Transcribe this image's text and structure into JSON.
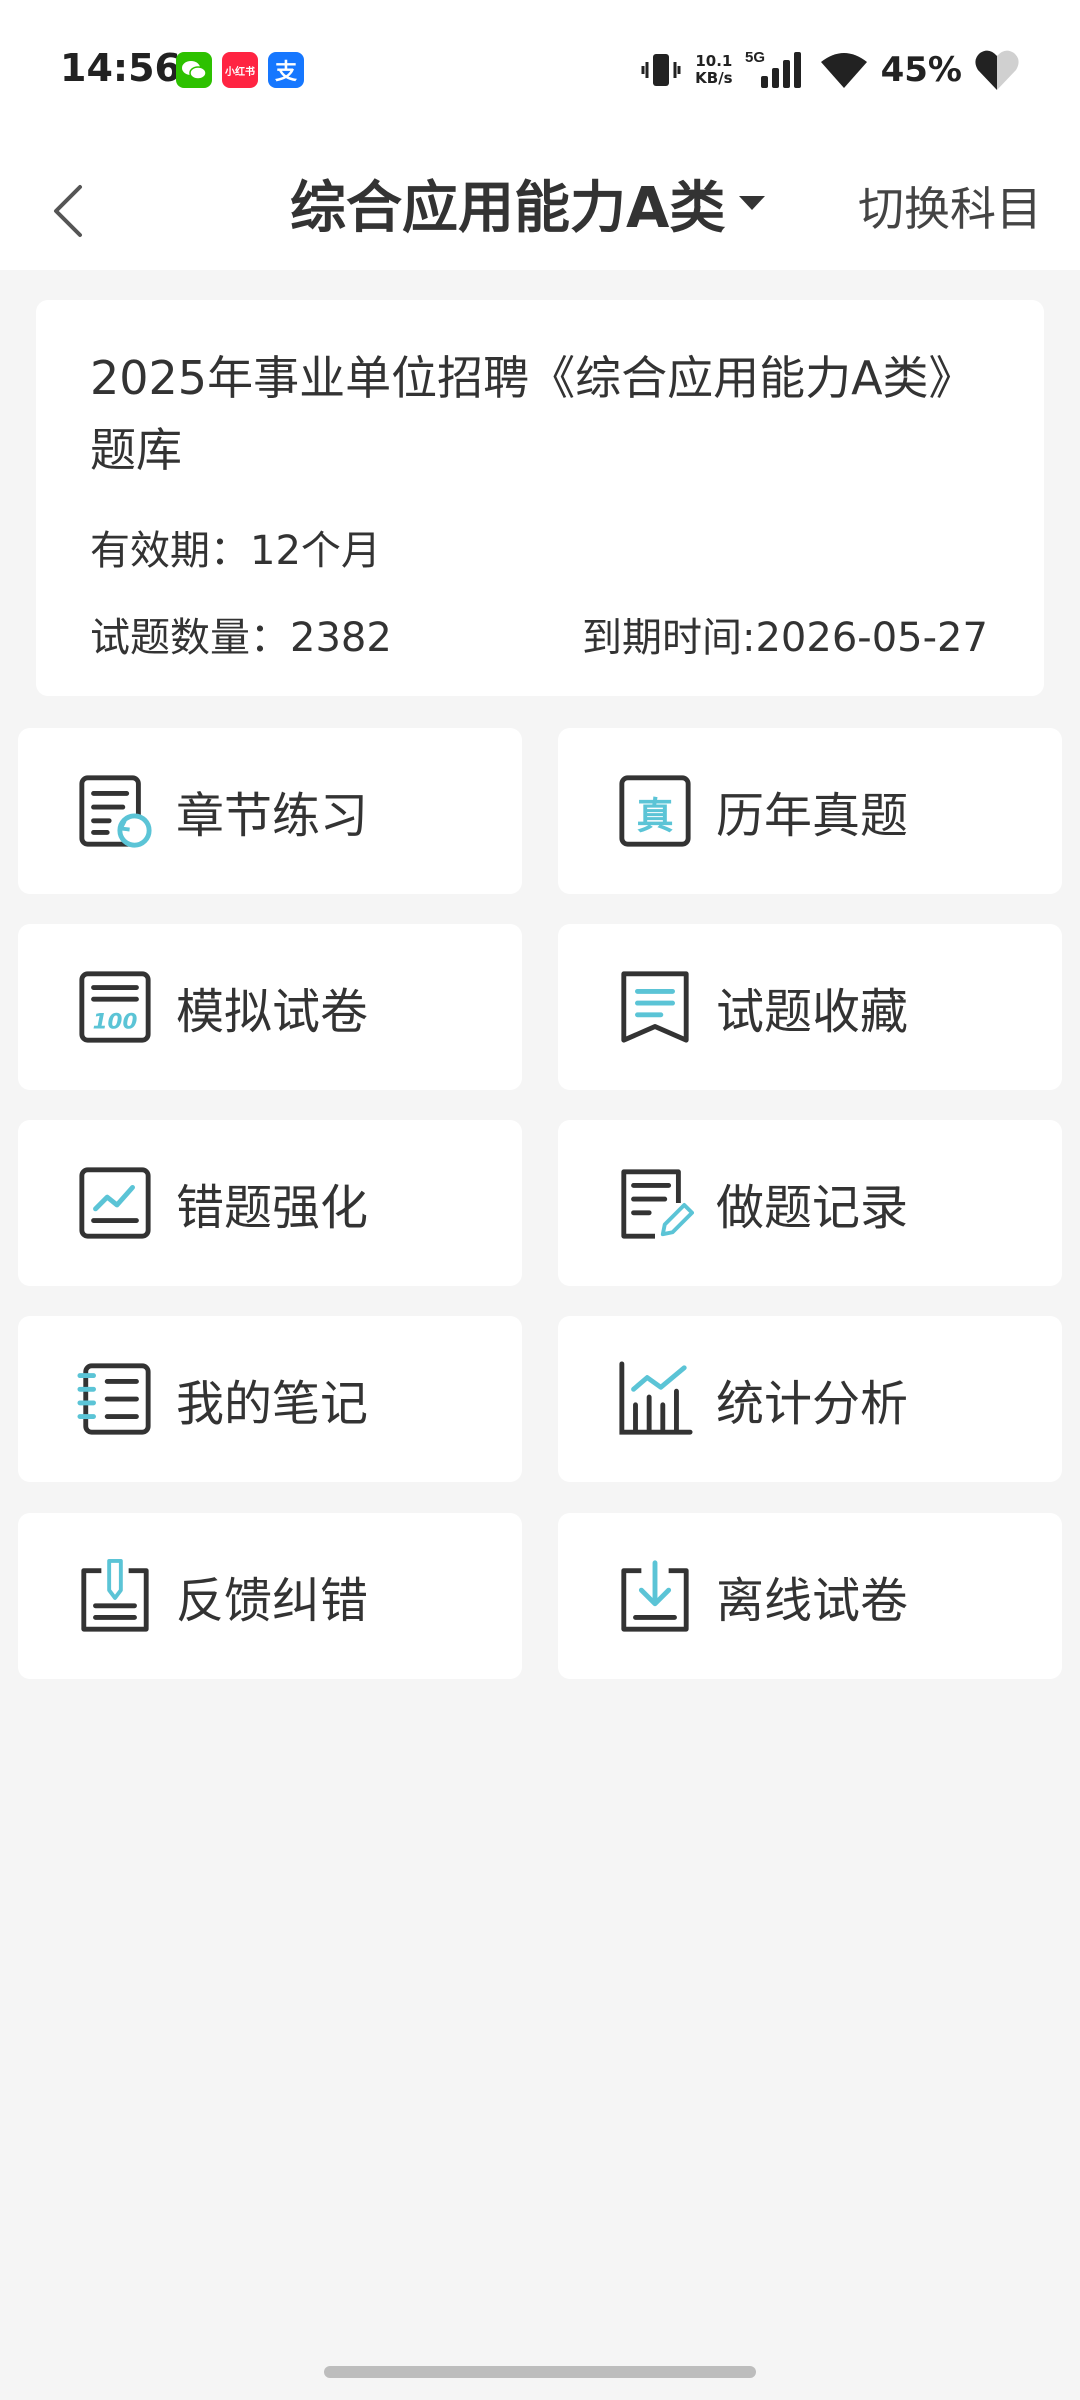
{
  "status_bar": {
    "time": "14:56",
    "apps": [
      {
        "name": "wechat-icon",
        "glyph": "◉"
      },
      {
        "name": "xiaohongshu-icon",
        "glyph": "小红书"
      },
      {
        "name": "alipay-icon",
        "glyph": "支"
      }
    ],
    "net_speed_value": "10.1",
    "net_speed_unit": "KB/s",
    "network": "5G",
    "battery": "45%"
  },
  "header": {
    "title": "综合应用能力A类",
    "switch_label": "切换科目"
  },
  "info_card": {
    "title": "2025年事业单位招聘《综合应用能力A类》题库",
    "validity": "有效期：12个月",
    "question_count": "试题数量：2382",
    "expire_time": "到期时间:2026-05-27"
  },
  "menu": [
    {
      "label": "章节练习",
      "icon": "chapter-practice-icon"
    },
    {
      "label": "历年真题",
      "icon": "past-papers-icon"
    },
    {
      "label": "模拟试卷",
      "icon": "mock-exam-icon"
    },
    {
      "label": "试题收藏",
      "icon": "favorites-icon"
    },
    {
      "label": "错题强化",
      "icon": "wrong-questions-icon"
    },
    {
      "label": "做题记录",
      "icon": "practice-record-icon"
    },
    {
      "label": "我的笔记",
      "icon": "notes-icon"
    },
    {
      "label": "统计分析",
      "icon": "statistics-icon"
    },
    {
      "label": "反馈纠错",
      "icon": "feedback-icon"
    },
    {
      "label": "离线试卷",
      "icon": "offline-download-icon"
    }
  ],
  "colors": {
    "accent": "#5bc4d6",
    "icon_stroke": "#333333",
    "background": "#f5f5f5"
  }
}
